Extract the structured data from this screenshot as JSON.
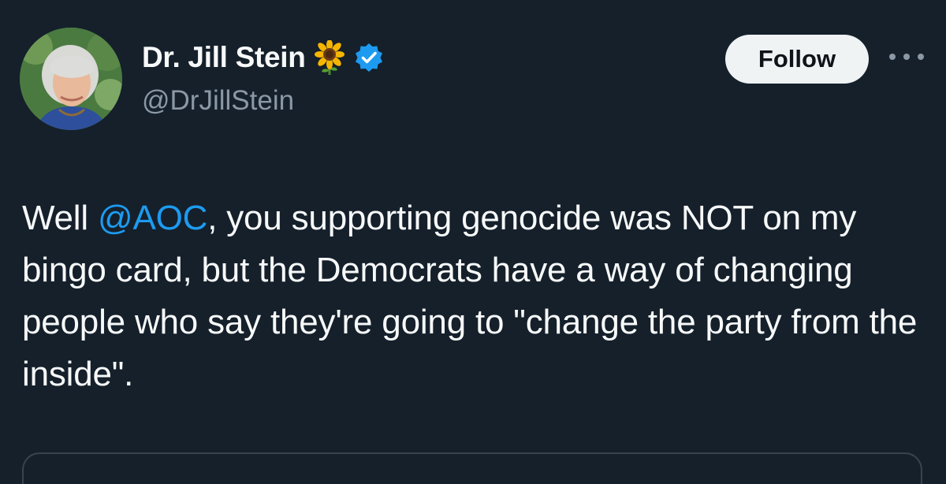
{
  "author": {
    "display_name": "Dr. Jill Stein",
    "name_emoji": "sunflower-icon",
    "verified": true,
    "handle": "@DrJillStein"
  },
  "actions": {
    "follow_label": "Follow",
    "more_icon": "more-horizontal-icon"
  },
  "tweet": {
    "text_before": "Well ",
    "mention": "@AOC",
    "text_after": ", you supporting genocide was NOT on my bingo card, but the Democrats have a way of changing people who say they're going to \"change the party from the inside\"."
  },
  "colors": {
    "background": "#15202b",
    "text_primary": "#f7f9f9",
    "text_secondary": "#8b98a5",
    "link": "#1d9bf0",
    "verified_badge": "#1d9bf0",
    "follow_button_bg": "#eff3f4"
  }
}
